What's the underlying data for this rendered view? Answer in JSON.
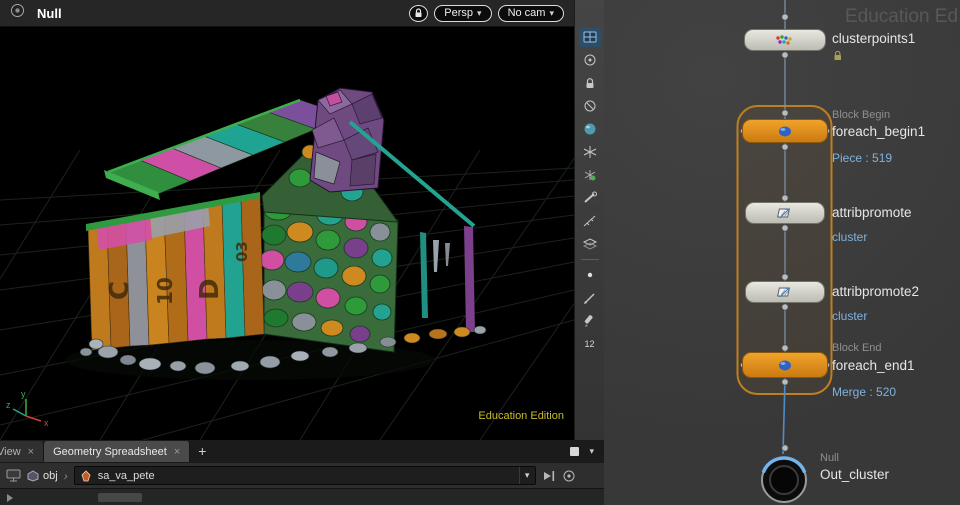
{
  "icons": {
    "dropdown_arrow": "▾",
    "close": "×",
    "add_tab": "+",
    "breadcrumb_sep": "›",
    "frame_label": "12"
  },
  "viewport": {
    "title": "Null",
    "persp": "Persp",
    "camera": "No cam",
    "watermark": "Education Edition",
    "axis_x": "x",
    "axis_y": "y",
    "axis_z": "z",
    "letters": [
      "C",
      "10",
      "D",
      "03"
    ]
  },
  "network": {
    "watermark": "Education Ed",
    "cluster_node": {
      "name": "clusterpoints1"
    },
    "foreach_begin": {
      "header": "Block Begin",
      "name": "foreach_begin1",
      "info": "Piece : 519"
    },
    "attribpromote": {
      "name": "attribpromote",
      "info": "cluster"
    },
    "attribpromote2": {
      "name": "attribpromote2",
      "info": "cluster"
    },
    "foreach_end": {
      "header": "Block End",
      "name": "foreach_end1",
      "info": "Merge : 520"
    },
    "out_null": {
      "header": "Null",
      "name": "Out_cluster"
    }
  },
  "tabs": {
    "view": "View",
    "geometry_spreadsheet": "Geometry Spreadsheet"
  },
  "pathbar": {
    "root": "obj",
    "node": "sa_va_pete"
  },
  "colors": {
    "node_orange": "#e08a1e",
    "wire_blue": "#5b8fc0",
    "info_blue": "#7fb2e0",
    "education_yellow": "#c9bd2a",
    "foreach_outline": "#bf7f1f",
    "network_bg": "#3c3c3c"
  }
}
